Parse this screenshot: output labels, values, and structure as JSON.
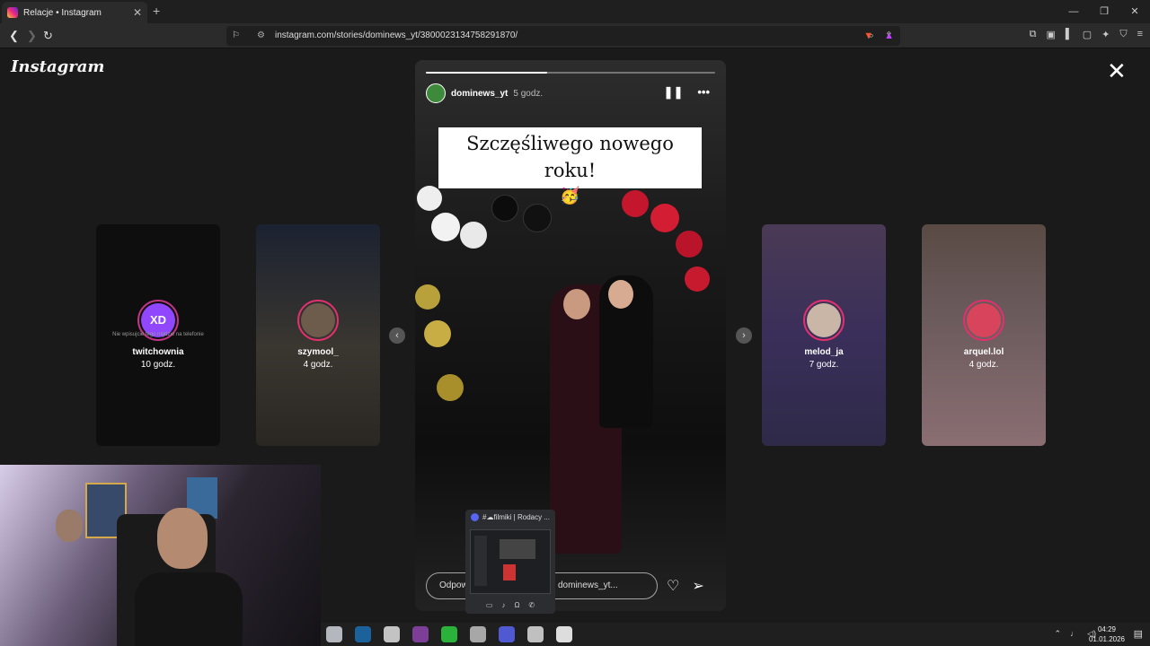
{
  "browser": {
    "tab_title": "Relacje • Instagram",
    "new_tab": "+",
    "close_tab": "✕",
    "url": "instagram.com/stories/dominews_yt/3800023134758291870/",
    "window_controls": [
      "—",
      "❐",
      "✕"
    ]
  },
  "instagram": {
    "logo": "Instagram",
    "close": "✕",
    "prev_arrow": "‹",
    "next_arrow": "›"
  },
  "side_stories": [
    {
      "name": "twitchownia",
      "time": "10 godz.",
      "avatar_text": "XD",
      "note": "Nie wpisujcie tego nigdzie na telefonie"
    },
    {
      "name": "szymool_",
      "time": "4 godz."
    },
    {
      "name": "melod_ja",
      "time": "7 godz."
    },
    {
      "name": "arquel.lol",
      "time": "4 godz."
    }
  ],
  "story": {
    "username": "dominews_yt",
    "time": "5 godz.",
    "progress": 0.42,
    "caption": "Szczęśliwego nowego roku!",
    "caption_emoji": "🥳",
    "reply_placeholder": "Odpowiedz dominews_yt...",
    "reply_visible_left": "Odpow",
    "reply_visible_right": "dominews_yt..."
  },
  "discord_popup": {
    "title": "#☁filmiki | Rodacy ..."
  },
  "taskbar": {
    "time": "04:29",
    "date": "01.01.2026",
    "icon_colors": [
      "#cfd4da",
      "#1b6fb3",
      "#e0e0e0",
      "#8e44ad",
      "#2ecc40",
      "#c0c0c0",
      "#5865f2",
      "#dddddd",
      "#ffffff"
    ]
  },
  "colors": {
    "accent_ring": "#e1306c",
    "twitch_purple": "#9146ff"
  }
}
